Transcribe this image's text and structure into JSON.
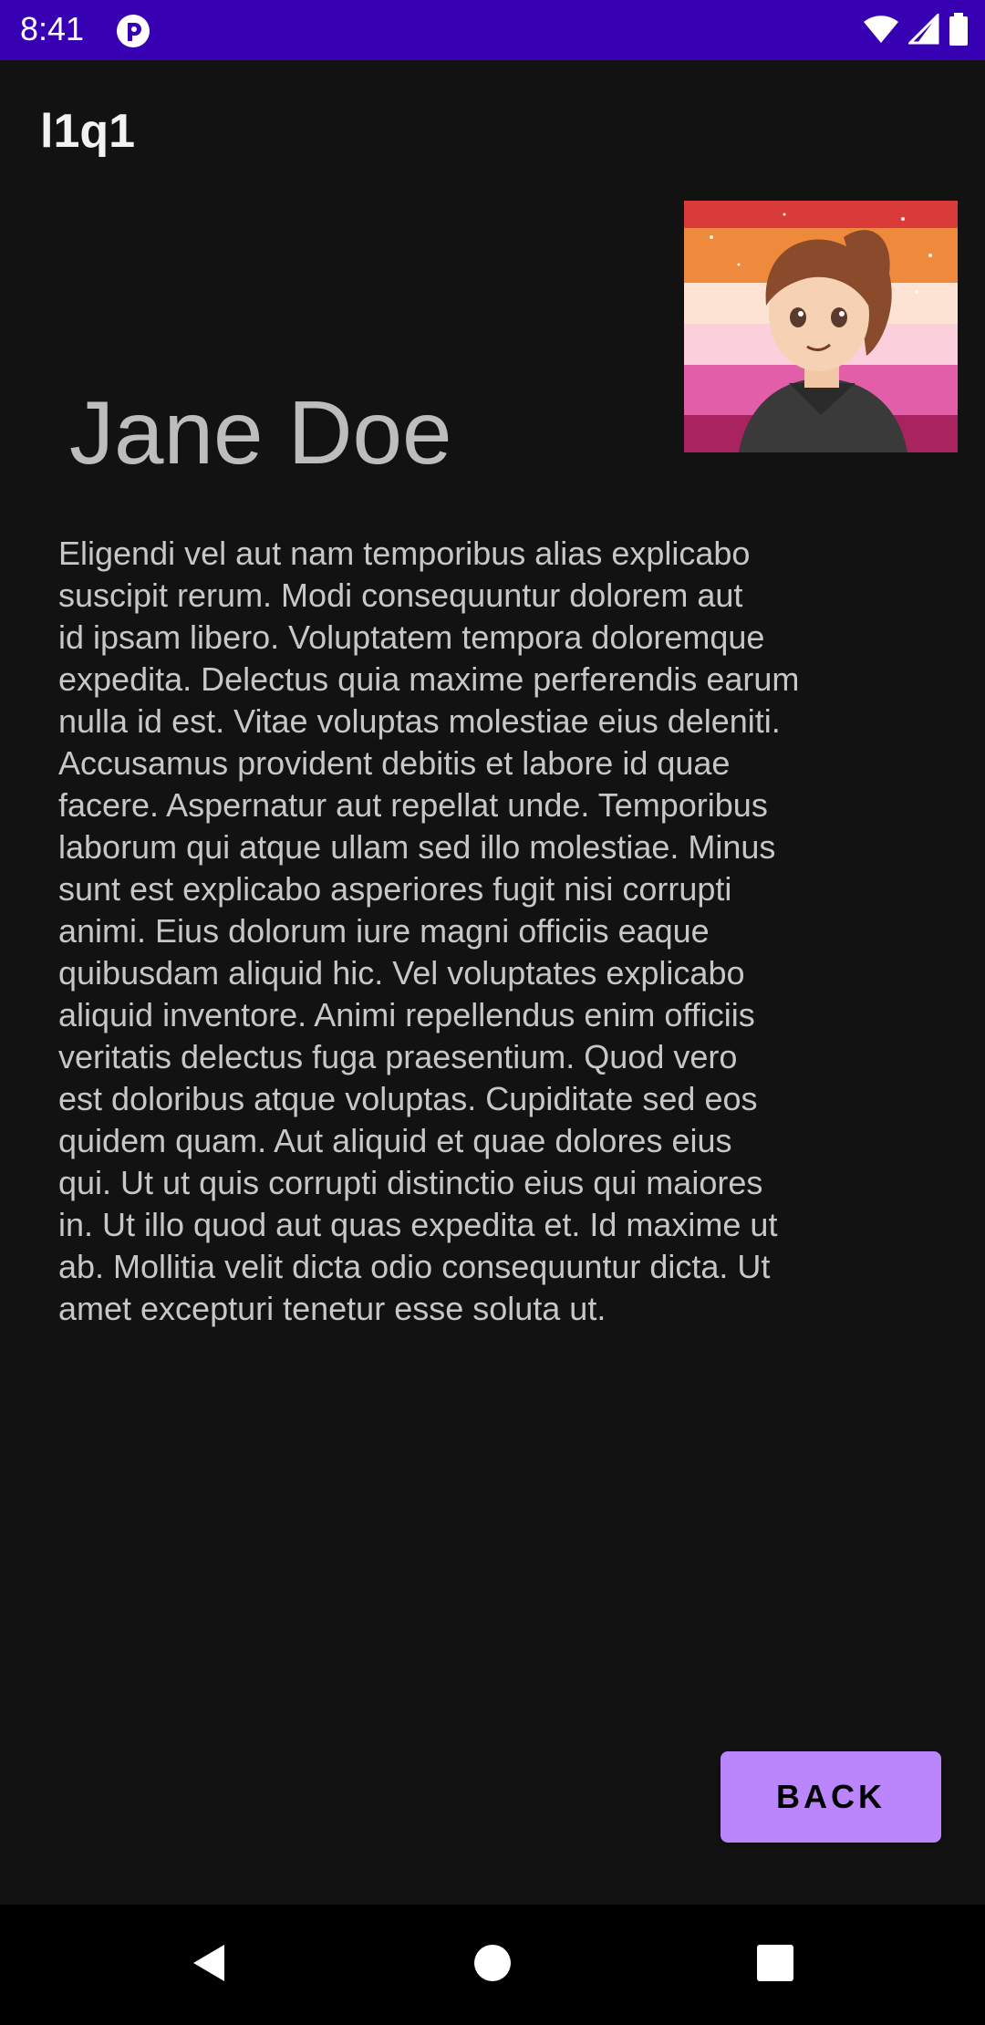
{
  "status_bar": {
    "time": "8:41",
    "icons": [
      "app-notification-icon",
      "wifi-icon",
      "cellular-signal-icon",
      "battery-icon"
    ],
    "background": "#3700b3"
  },
  "app_bar": {
    "title": "l1q1"
  },
  "profile": {
    "name": "Jane Doe",
    "avatar_icon": "avatar-illustration",
    "bio": "Eligendi vel aut nam temporibus alias explicabo\nsuscipit rerum. Modi consequuntur dolorem aut\nid ipsam libero. Voluptatem tempora doloremque\nexpedita. Delectus quia maxime perferendis earum\nnulla id est. Vitae voluptas molestiae eius deleniti.\nAccusamus provident debitis et labore id quae\nfacere. Aspernatur aut repellat unde. Temporibus\nlaborum qui atque ullam sed illo molestiae. Minus\nsunt est explicabo asperiores fugit nisi corrupti\nanimi. Eius dolorum iure magni officiis eaque\nquibusdam aliquid hic. Vel voluptates explicabo\naliquid inventore. Animi repellendus enim officiis\nveritatis delectus fuga praesentium. Quod vero\nest doloribus atque voluptas. Cupiditate sed eos\nquidem quam. Aut aliquid et quae dolores eius\nqui. Ut ut quis corrupti distinctio eius qui maiores\nin. Ut illo quod aut quas expedita et. Id maxime ut\nab. Mollitia velit dicta odio consequuntur dicta. Ut\namet excepturi tenetur esse soluta ut."
  },
  "actions": {
    "back_label": "BACK"
  },
  "nav_bar": {
    "icons": [
      "back-triangle-icon",
      "home-circle-icon",
      "recents-square-icon"
    ]
  },
  "colors": {
    "background": "#121212",
    "accent": "#bb86fc",
    "status_bar": "#3700b3"
  }
}
